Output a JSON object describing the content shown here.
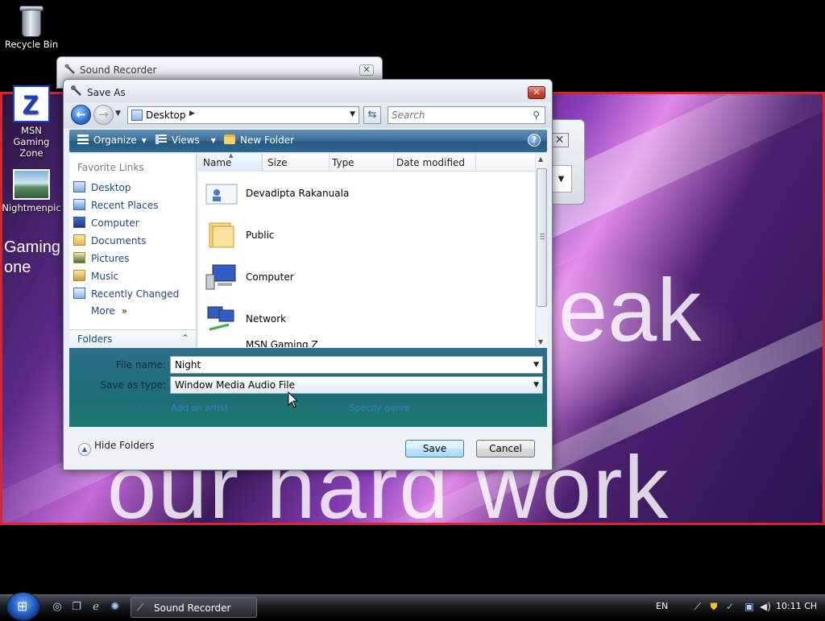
{
  "desktop": {
    "icons": [
      {
        "label": "Recycle Bin",
        "icon": "recycle-bin-icon"
      },
      {
        "label": "MSN Gaming Zone",
        "icon": "msn-gaming-zone-icon"
      },
      {
        "label": "Nightmenpic",
        "icon": "picture-file-icon"
      }
    ],
    "background_window": {
      "text_line_1": "eak",
      "text_line_2": "our hard work",
      "side_text": "Gaming\none"
    },
    "accent_border_color": "#d8262b"
  },
  "sound_recorder_window": {
    "title": "Sound Recorder",
    "close_glyph": "✕"
  },
  "save_dialog": {
    "title": "Save As",
    "close_glyph": "✕",
    "navigation": {
      "address": "Desktop",
      "search_placeholder": "Search"
    },
    "toolbar": {
      "organize_label": "Organize",
      "views_label": "Views",
      "new_folder_label": "New Folder",
      "help_glyph": "?"
    },
    "favorite_links": {
      "header": "Favorite Links",
      "items": [
        {
          "label": "Desktop",
          "icon": "desktop-icon"
        },
        {
          "label": "Recent Places",
          "icon": "recent-places-icon"
        },
        {
          "label": "Computer",
          "icon": "computer-icon"
        },
        {
          "label": "Documents",
          "icon": "documents-icon"
        },
        {
          "label": "Pictures",
          "icon": "pictures-icon"
        },
        {
          "label": "Music",
          "icon": "music-icon"
        },
        {
          "label": "Recently Changed",
          "icon": "recently-changed-icon"
        },
        {
          "label": "More",
          "icon": "double-chevron-icon"
        }
      ],
      "folders_label": "Folders"
    },
    "file_list": {
      "columns": [
        "Name",
        "Size",
        "Type",
        "Date modified"
      ],
      "items": [
        {
          "name": "Devadipta Rakanuala",
          "icon": "user-folder-icon"
        },
        {
          "name": "Public",
          "icon": "folder-icon"
        },
        {
          "name": "Computer",
          "icon": "computer-icon"
        },
        {
          "name": "Network",
          "icon": "network-icon"
        },
        {
          "name": "MSN Gaming Z",
          "icon": "msn-gaming-zone-icon"
        }
      ]
    },
    "form": {
      "file_name_label": "File name:",
      "file_name_value": "Night",
      "save_type_label": "Save as type:",
      "save_type_value": "Window Media Audio File",
      "artists_label": "Artists:",
      "artists_value": "Add an artist",
      "genre_label": "Genre:",
      "genre_value": "Specify genre"
    },
    "buttons": {
      "hide_folders_label": "Hide Folders",
      "save_label": "Save",
      "cancel_label": "Cancel"
    }
  },
  "taskbar": {
    "active_task_label": "Sound Recorder",
    "language": "EN",
    "clock": "10:11 CH"
  }
}
